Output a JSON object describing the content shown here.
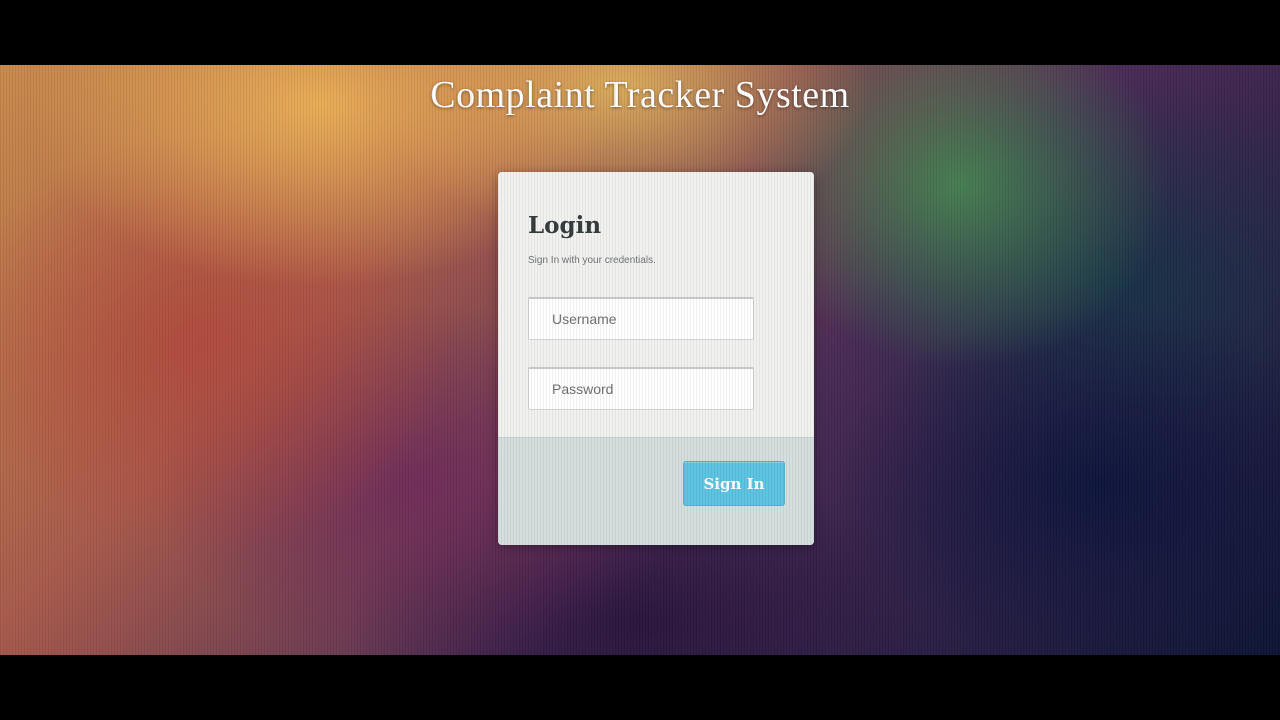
{
  "app": {
    "title": "Complaint Tracker System"
  },
  "login": {
    "heading": "Login",
    "subtitle": "Sign In with your credentials.",
    "username": {
      "value": "",
      "placeholder": "Username"
    },
    "password": {
      "value": "",
      "placeholder": "Password"
    },
    "submit_label": "Sign In"
  },
  "colors": {
    "accent": "#5bc3e1",
    "card_background": "#f1f2f0",
    "footer_background": "#d3dedd",
    "heading_text": "#333a3c"
  }
}
